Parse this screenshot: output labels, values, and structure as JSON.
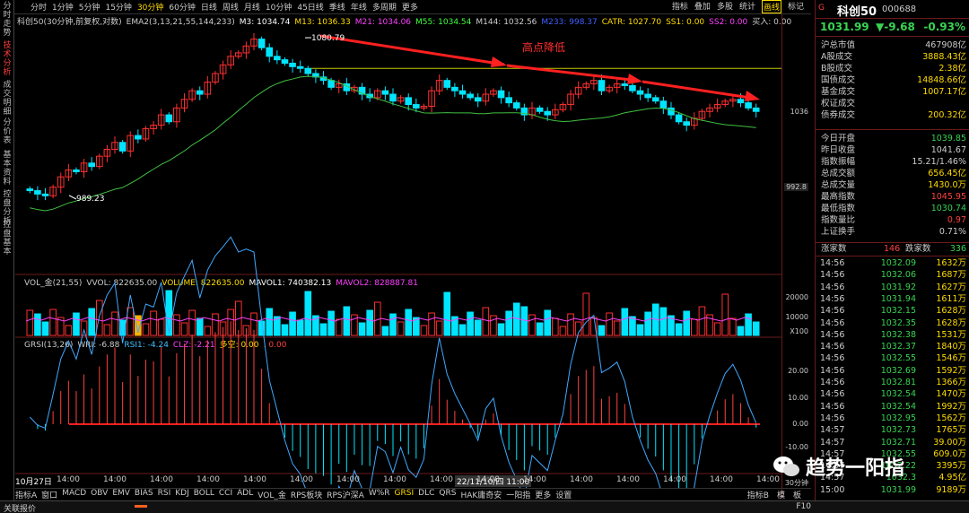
{
  "left_tabs": [
    "分时走势",
    "技术分析",
    "成交明细",
    "分价表",
    "基本资料",
    "控盘分析",
    "控盘基本"
  ],
  "toolbar": {
    "periods": [
      "分时",
      "1分钟",
      "5分钟",
      "15分钟",
      "30分钟",
      "60分钟",
      "日线",
      "周线",
      "月线",
      "10分钟",
      "45日线",
      "季线",
      "年线",
      "多周期",
      "更多"
    ],
    "active_period": "30分钟",
    "right_items": [
      "指标",
      "叠加",
      "多股",
      "统计",
      "画线",
      "标记"
    ]
  },
  "chart": {
    "legend_main": [
      {
        "text": "科创50(30分钟,前复权,对数)",
        "color": "#cccccc"
      },
      {
        "text": "EMA2(3,13,21,55,144,233)",
        "color": "#cccccc"
      },
      {
        "text": "M3: 1034.74",
        "color": "#ffffff"
      },
      {
        "text": "M13: 1036.33",
        "color": "#ffdc00"
      },
      {
        "text": "M21: 1034.06",
        "color": "#ff40ff"
      },
      {
        "text": "M55: 1034.54",
        "color": "#40ff40"
      },
      {
        "text": "M144: 1032.56",
        "color": "#cccccc"
      },
      {
        "text": "M233: 998.37",
        "color": "#4060ff"
      },
      {
        "text": "CATR: 1027.70",
        "color": "#ffdc00"
      },
      {
        "text": "SS1: 0.00",
        "color": "#ffdc00"
      },
      {
        "text": "SS2: 0.00",
        "color": "#ff40ff"
      },
      {
        "text": "买入: 0.00",
        "color": "#cccccc"
      }
    ],
    "legend_vol": [
      {
        "text": "VOL_金(21,55)",
        "color": "#cccccc"
      },
      {
        "text": "VVOL: 822635.00",
        "color": "#cccccc"
      },
      {
        "text": "VOLUME: 822635.00",
        "color": "#ffdc00"
      },
      {
        "text": "MAVOL1: 740382.13",
        "color": "#ffffff"
      },
      {
        "text": "MAVOL2: 828887.81",
        "color": "#ff40ff"
      }
    ],
    "legend_grsi": [
      {
        "text": "GRSI(13,26)",
        "color": "#cccccc"
      },
      {
        "text": "WRI: -6.88",
        "color": "#cccccc"
      },
      {
        "text": "RSI1: -4.24",
        "color": "#40c0ff"
      },
      {
        "text": "CLZ: -2.21",
        "color": "#ff40ff"
      },
      {
        "text": "多空: 0.00",
        "color": "#ffdc00"
      },
      {
        "text": ": 0.00",
        "color": "#ff4040"
      }
    ],
    "annotation": "高点降低",
    "high_label": "1080.79",
    "low_label": "989.23",
    "price_axis": {
      "current": "1036",
      "lower": "992.8"
    },
    "vol_axis": [
      "20000",
      "10000",
      "X100"
    ],
    "grsi_axis": [
      "20.00",
      "10.00",
      "0.00",
      "-10.00"
    ],
    "date_label": "10月27日",
    "crosshair_label": "22/11/10/四 11:00",
    "time_ticks": [
      "14:00",
      "14:00",
      "14:00",
      "14:00",
      "14:00",
      "14:00",
      "14:00",
      "14:00",
      "14:00",
      "14:00",
      "14:00",
      "14:00",
      "14:00",
      "14:00",
      "14:00",
      "14:00"
    ],
    "time_tail": "30分钟",
    "chart_data": {
      "type": "candlestick",
      "series_close": [
        992,
        990,
        989,
        994,
        1000,
        1004,
        1003,
        1008,
        1006,
        1012,
        1016,
        1020,
        1015,
        1024,
        1022,
        1028,
        1030,
        1036,
        1032,
        1040,
        1045,
        1050,
        1048,
        1055,
        1060,
        1065,
        1070,
        1072,
        1076,
        1080,
        1075,
        1070,
        1068,
        1066,
        1064,
        1063,
        1060,
        1058,
        1056,
        1052,
        1054,
        1050,
        1052,
        1048,
        1046,
        1050,
        1048,
        1044,
        1046,
        1042,
        1040,
        1041,
        1050,
        1056,
        1052,
        1050,
        1048,
        1046,
        1044,
        1048,
        1050,
        1046,
        1043,
        1040,
        1036,
        1040,
        1038,
        1036,
        1039,
        1042,
        1048,
        1052,
        1054,
        1056,
        1050,
        1052,
        1054,
        1053,
        1050,
        1048,
        1046,
        1044,
        1040,
        1036,
        1032,
        1030,
        1034,
        1038,
        1040,
        1042,
        1044,
        1045,
        1043,
        1040,
        1038
      ],
      "high_point": 1080.79,
      "low_point": 989.23,
      "level_line": 1063
    }
  },
  "bottom_tabs": [
    "指标A",
    "窗口",
    "MACD",
    "OBV",
    "EMV",
    "BIAS",
    "RSI",
    "KDJ",
    "BOLL",
    "CCI",
    "ADL",
    "VOL_金",
    "RPS板块",
    "RPS沪深A",
    "W%R",
    "GRSI",
    "DLC",
    "QRS",
    "HAK庸奇安",
    "一阳指",
    "更多",
    "设置"
  ],
  "bottom_active": "GRSI",
  "bottom_right": [
    "指标B",
    "模",
    "板"
  ],
  "status": {
    "left": "关联报价",
    "right": "F10"
  },
  "quote": {
    "flag": "G",
    "name": "科创50",
    "code": "000688",
    "price": "1031.99",
    "change": "▼-9.68",
    "pct": "-0.93%",
    "rows": [
      {
        "k": "沪总市值",
        "v": "467908亿",
        "c": "#cccccc"
      },
      {
        "k": "A股成交",
        "v": "3888.43亿",
        "c": "#ffdc00"
      },
      {
        "k": "B股成交",
        "v": "2.38亿",
        "c": "#ffdc00"
      },
      {
        "k": "国债成交",
        "v": "14848.66亿",
        "c": "#ffdc00"
      },
      {
        "k": "基金成交",
        "v": "1007.17亿",
        "c": "#ffdc00"
      },
      {
        "k": "权证成交",
        "v": "",
        "c": "#ffdc00"
      },
      {
        "k": "债券成交",
        "v": "200.32亿",
        "c": "#ffdc00"
      },
      {
        "k": "今日开盘",
        "v": "1039.85",
        "c": "#39d353"
      },
      {
        "k": "昨日收盘",
        "v": "1041.67",
        "c": "#cccccc"
      },
      {
        "k": "指数振幅",
        "v": "15.21/1.46%",
        "c": "#cccccc"
      },
      {
        "k": "总成交额",
        "v": "656.45亿",
        "c": "#ffdc00"
      },
      {
        "k": "总成交量",
        "v": "1430.0万",
        "c": "#ffdc00"
      },
      {
        "k": "最高指数",
        "v": "1045.95",
        "c": "#ff4040"
      },
      {
        "k": "最低指数",
        "v": "1030.74",
        "c": "#39d353"
      },
      {
        "k": "指数量比",
        "v": "0.97",
        "c": "#ff4040"
      },
      {
        "k": "上证换手",
        "v": "0.71%",
        "c": "#cccccc"
      }
    ],
    "updown": {
      "up_label": "涨家数",
      "up": "146",
      "down_label": "跌家数",
      "down": "336"
    },
    "ticks": [
      [
        "14:56",
        "1032.09",
        "1632万"
      ],
      [
        "14:56",
        "1032.06",
        "1687万"
      ],
      [
        "14:56",
        "1031.92",
        "1627万"
      ],
      [
        "14:56",
        "1031.94",
        "1611万"
      ],
      [
        "14:56",
        "1032.15",
        "1628万"
      ],
      [
        "14:56",
        "1032.35",
        "1628万"
      ],
      [
        "14:56",
        "1032.38",
        "1531万"
      ],
      [
        "14:56",
        "1032.37",
        "1840万"
      ],
      [
        "14:56",
        "1032.55",
        "1546万"
      ],
      [
        "14:56",
        "1032.69",
        "1592万"
      ],
      [
        "14:56",
        "1032.81",
        "1366万"
      ],
      [
        "14:56",
        "1032.54",
        "1470万"
      ],
      [
        "14:56",
        "1032.54",
        "1992万"
      ],
      [
        "14:56",
        "1032.95",
        "1562万"
      ],
      [
        "14:57",
        "1032.73",
        "1765万"
      ],
      [
        "14:57",
        "1032.71",
        "39.00万"
      ],
      [
        "14:57",
        "1032.55",
        "609.0万"
      ],
      [
        "14:57",
        "1032.22",
        "3395万"
      ],
      [
        "14:57",
        "1032.3",
        "4.95亿"
      ],
      [
        "15:00",
        "1031.99",
        "9189万"
      ]
    ]
  },
  "watermark": "趋势一阳指"
}
